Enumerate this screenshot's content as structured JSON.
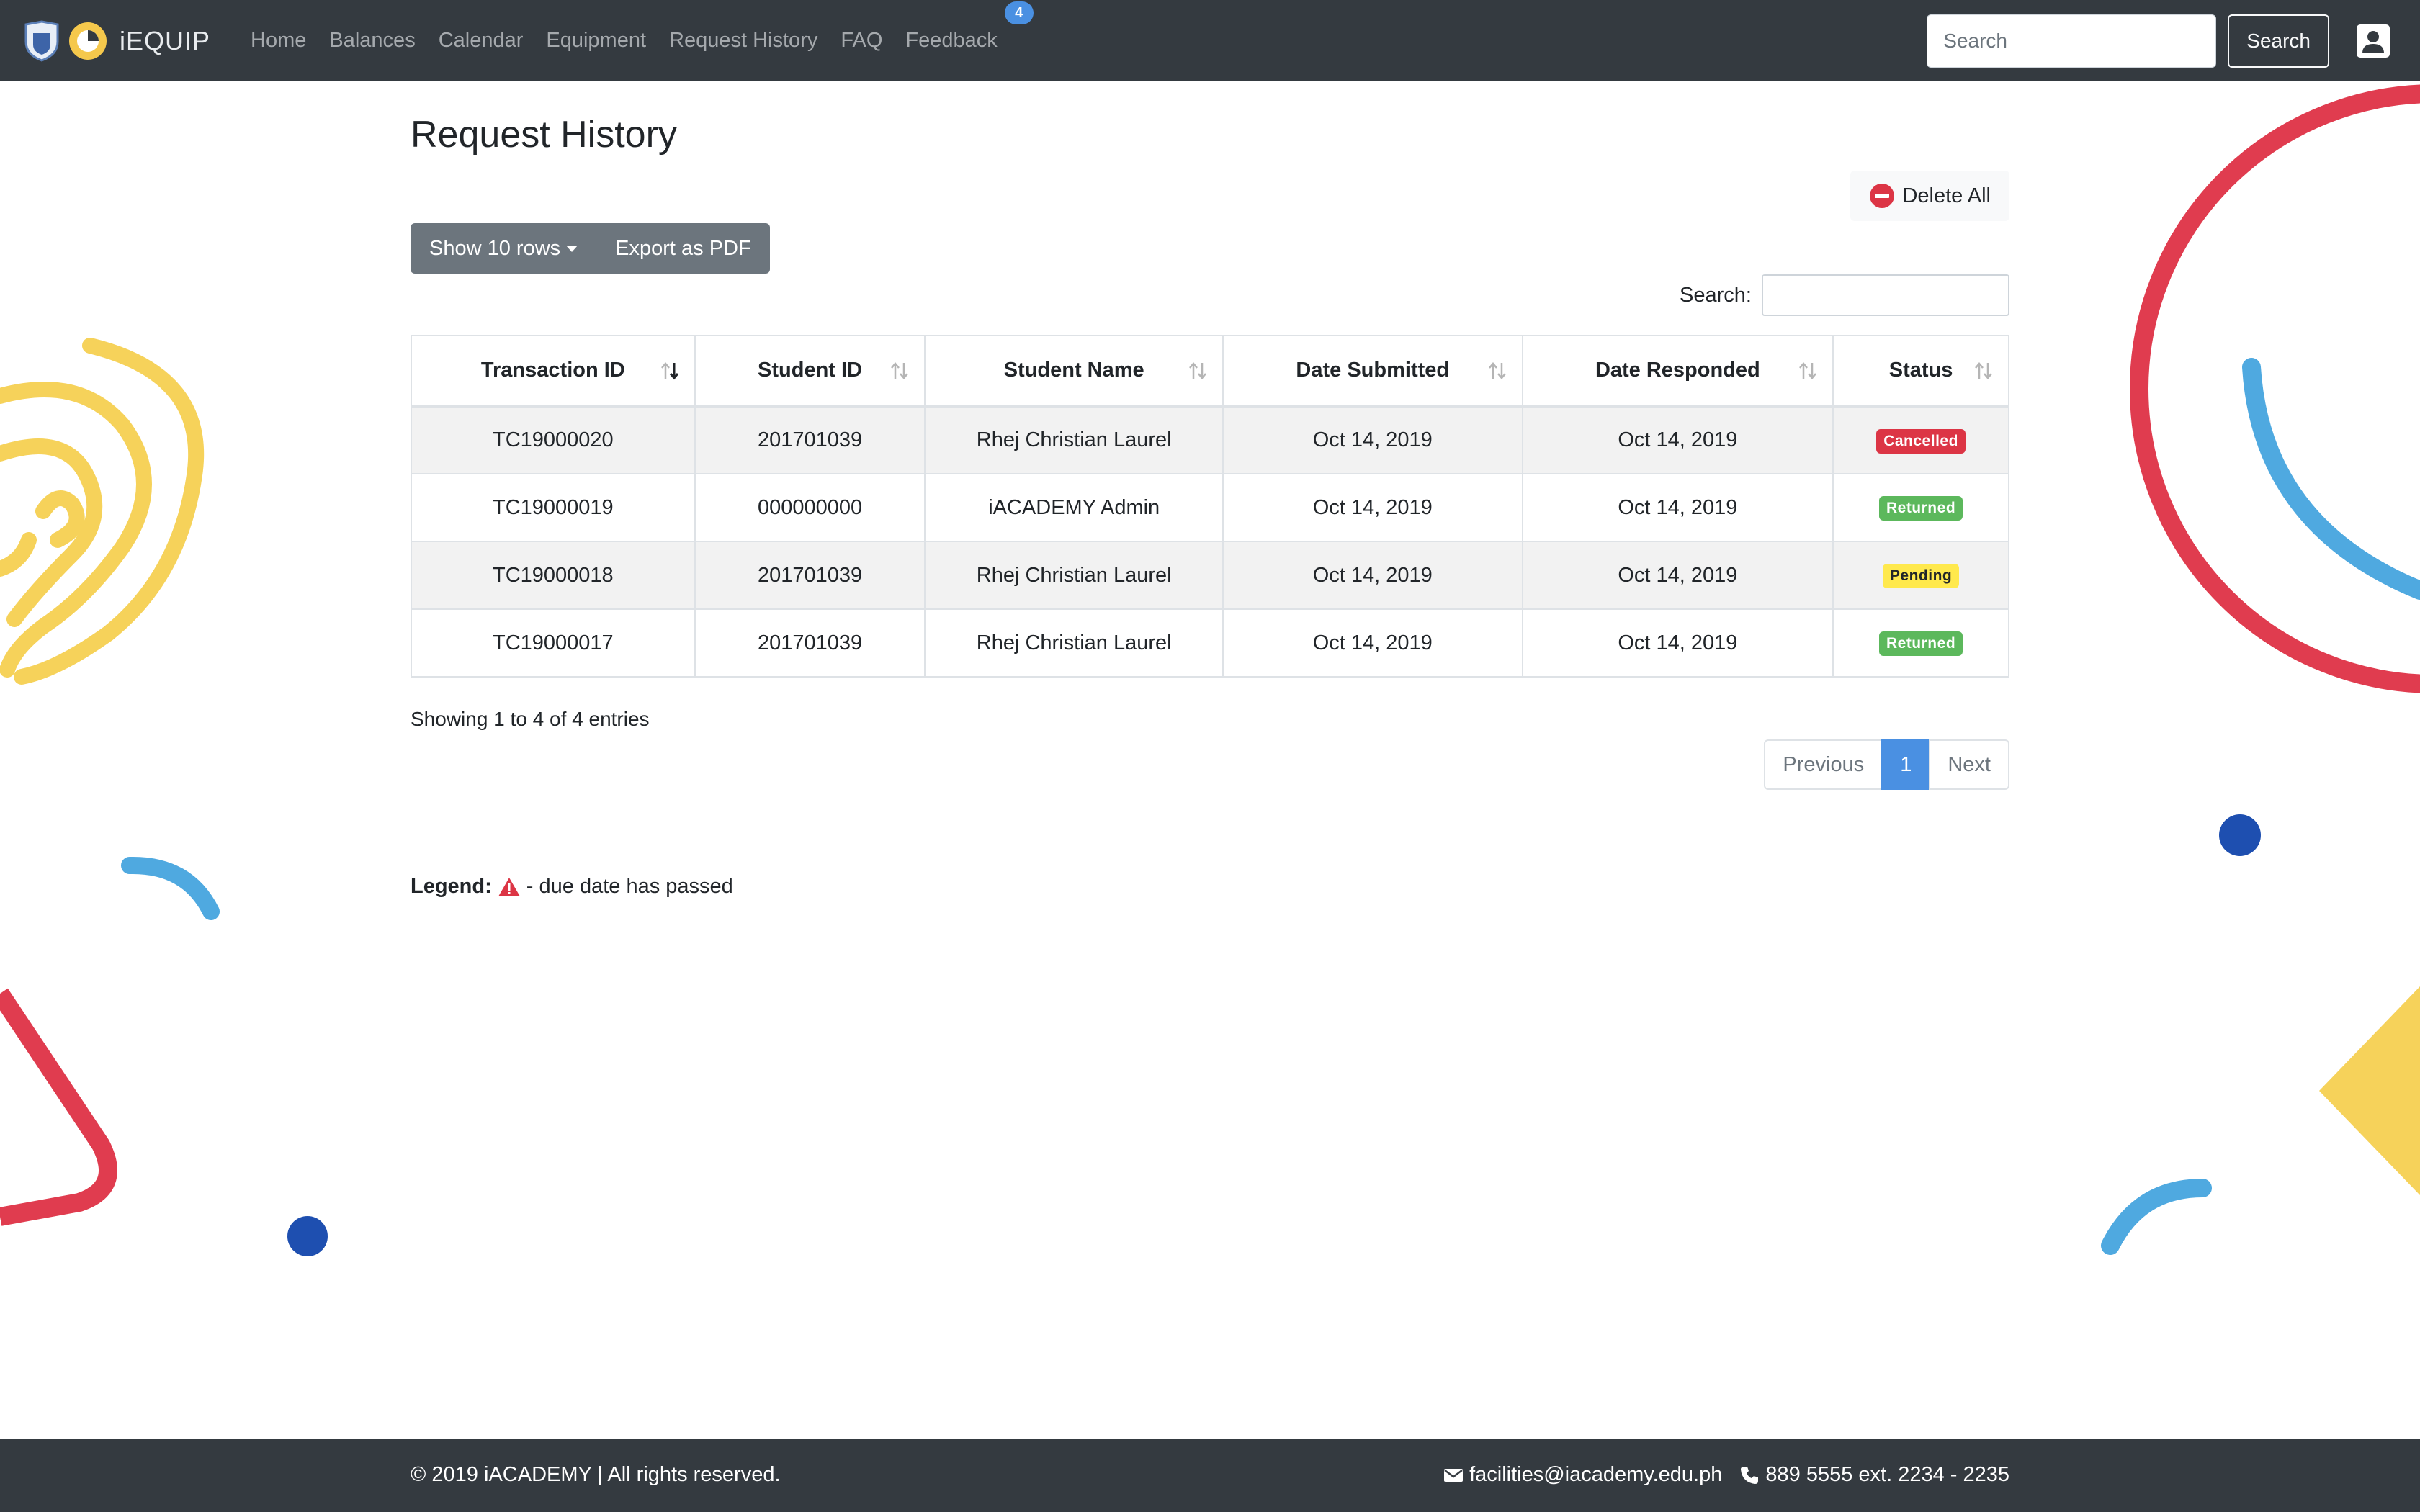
{
  "brand": {
    "name": "iEQUIP"
  },
  "nav": {
    "items": [
      {
        "label": "Home"
      },
      {
        "label": "Balances"
      },
      {
        "label": "Calendar"
      },
      {
        "label": "Equipment"
      },
      {
        "label": "Request History"
      },
      {
        "label": "FAQ"
      },
      {
        "label": "Feedback"
      }
    ],
    "feedback_badge": "4",
    "search_placeholder": "Search",
    "search_button": "Search"
  },
  "page": {
    "title": "Request History",
    "delete_all": "Delete All",
    "show_rows": "Show 10 rows",
    "export_pdf": "Export as PDF",
    "search_label": "Search:"
  },
  "table": {
    "headers": [
      "Transaction ID",
      "Student ID",
      "Student Name",
      "Date Submitted",
      "Date Responded",
      "Status"
    ],
    "rows": [
      [
        "TC19000020",
        "201701039",
        "Rhej Christian Laurel",
        "Oct 14, 2019",
        "Oct 14, 2019",
        "Cancelled"
      ],
      [
        "TC19000019",
        "000000000",
        "iACADEMY Admin",
        "Oct 14, 2019",
        "Oct 14, 2019",
        "Returned"
      ],
      [
        "TC19000018",
        "201701039",
        "Rhej Christian Laurel",
        "Oct 14, 2019",
        "Oct 14, 2019",
        "Pending"
      ],
      [
        "TC19000017",
        "201701039",
        "Rhej Christian Laurel",
        "Oct 14, 2019",
        "Oct 14, 2019",
        "Returned"
      ]
    ]
  },
  "info": "Showing 1 to 4 of 4 entries",
  "pagination": {
    "previous": "Previous",
    "current": "1",
    "next": "Next"
  },
  "legend": {
    "label": "Legend:",
    "text": "- due date has passed"
  },
  "footer": {
    "copyright": "© 2019 iACADEMY | All rights reserved.",
    "email": "facilities@iacademy.edu.ph",
    "phone": "889 5555 ext. 2234 - 2235"
  },
  "colors": {
    "navbar": "#343a40",
    "accent_blue": "#4a90e2",
    "cancelled": "#dc3545",
    "returned": "#5cb85c",
    "pending": "#ffe94d"
  }
}
